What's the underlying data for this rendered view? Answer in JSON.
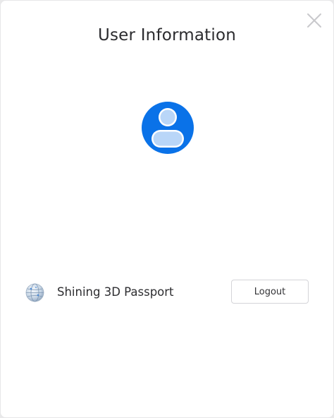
{
  "dialog": {
    "title": "User Information",
    "close_icon": "close-icon"
  },
  "avatar": {
    "icon": "user-avatar-icon",
    "accent_color": "#0a72e8"
  },
  "account": {
    "icon": "globe-icon",
    "name": "Shining 3D Passport",
    "logout_label": "Logout"
  }
}
